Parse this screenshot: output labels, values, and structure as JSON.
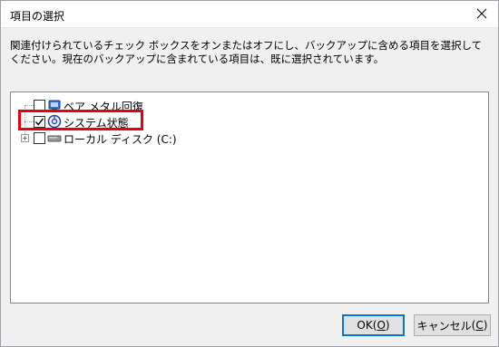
{
  "window": {
    "title": "項目の選択",
    "close_glyph": "✕"
  },
  "instructions": "関連付けられているチェック ボックスをオンまたはオフにし、バックアップに含める項目を選択してください。現在のバックアップに含まれている項目は、既に選択されています。",
  "tree": {
    "items": [
      {
        "label": "ベア メタル回復",
        "checked": false,
        "expander": "",
        "icon": "bare-metal-icon"
      },
      {
        "label": "システム状態",
        "checked": true,
        "expander": "",
        "icon": "system-state-icon"
      },
      {
        "label": "ローカル ディスク (C:)",
        "checked": false,
        "expander": "+",
        "icon": "local-disk-icon"
      }
    ]
  },
  "buttons": {
    "ok_label": "OK",
    "ok_mnemonic": "O",
    "cancel_label": "キャンセル",
    "cancel_mnemonic": "C"
  },
  "colors": {
    "highlight": "#e60012",
    "default_button_border": "#0078d7"
  }
}
